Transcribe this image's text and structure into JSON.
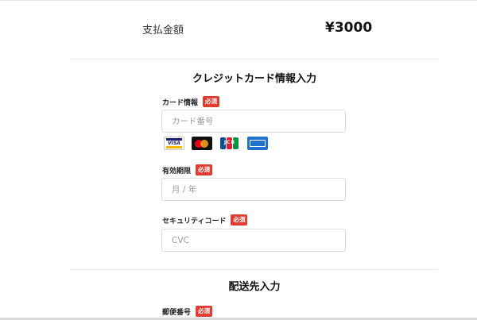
{
  "summary": {
    "label": "支払金額",
    "amount": "¥3000"
  },
  "card_section": {
    "title": "クレジットカード情報入力",
    "card_info": {
      "label": "カード情報",
      "badge": "必須",
      "placeholder": "カード番号"
    },
    "brands": [
      {
        "name": "visa-card-icon",
        "text": "VISA"
      },
      {
        "name": "mastercard-icon"
      },
      {
        "name": "jcb-card-icon",
        "text": "JCB"
      },
      {
        "name": "amex-card-icon"
      }
    ],
    "expiry": {
      "label": "有効期限",
      "badge": "必須",
      "placeholder": "月 / 年"
    },
    "security": {
      "label": "セキュリティコード",
      "badge": "必須",
      "placeholder": "CVC"
    }
  },
  "shipping_section": {
    "title": "配送先入力",
    "postal": {
      "label": "郵便番号",
      "badge": "必須"
    }
  },
  "colors": {
    "required_badge": "#e03c31",
    "visa_blue": "#1a1f71",
    "amex_blue": "#1f72cd"
  }
}
